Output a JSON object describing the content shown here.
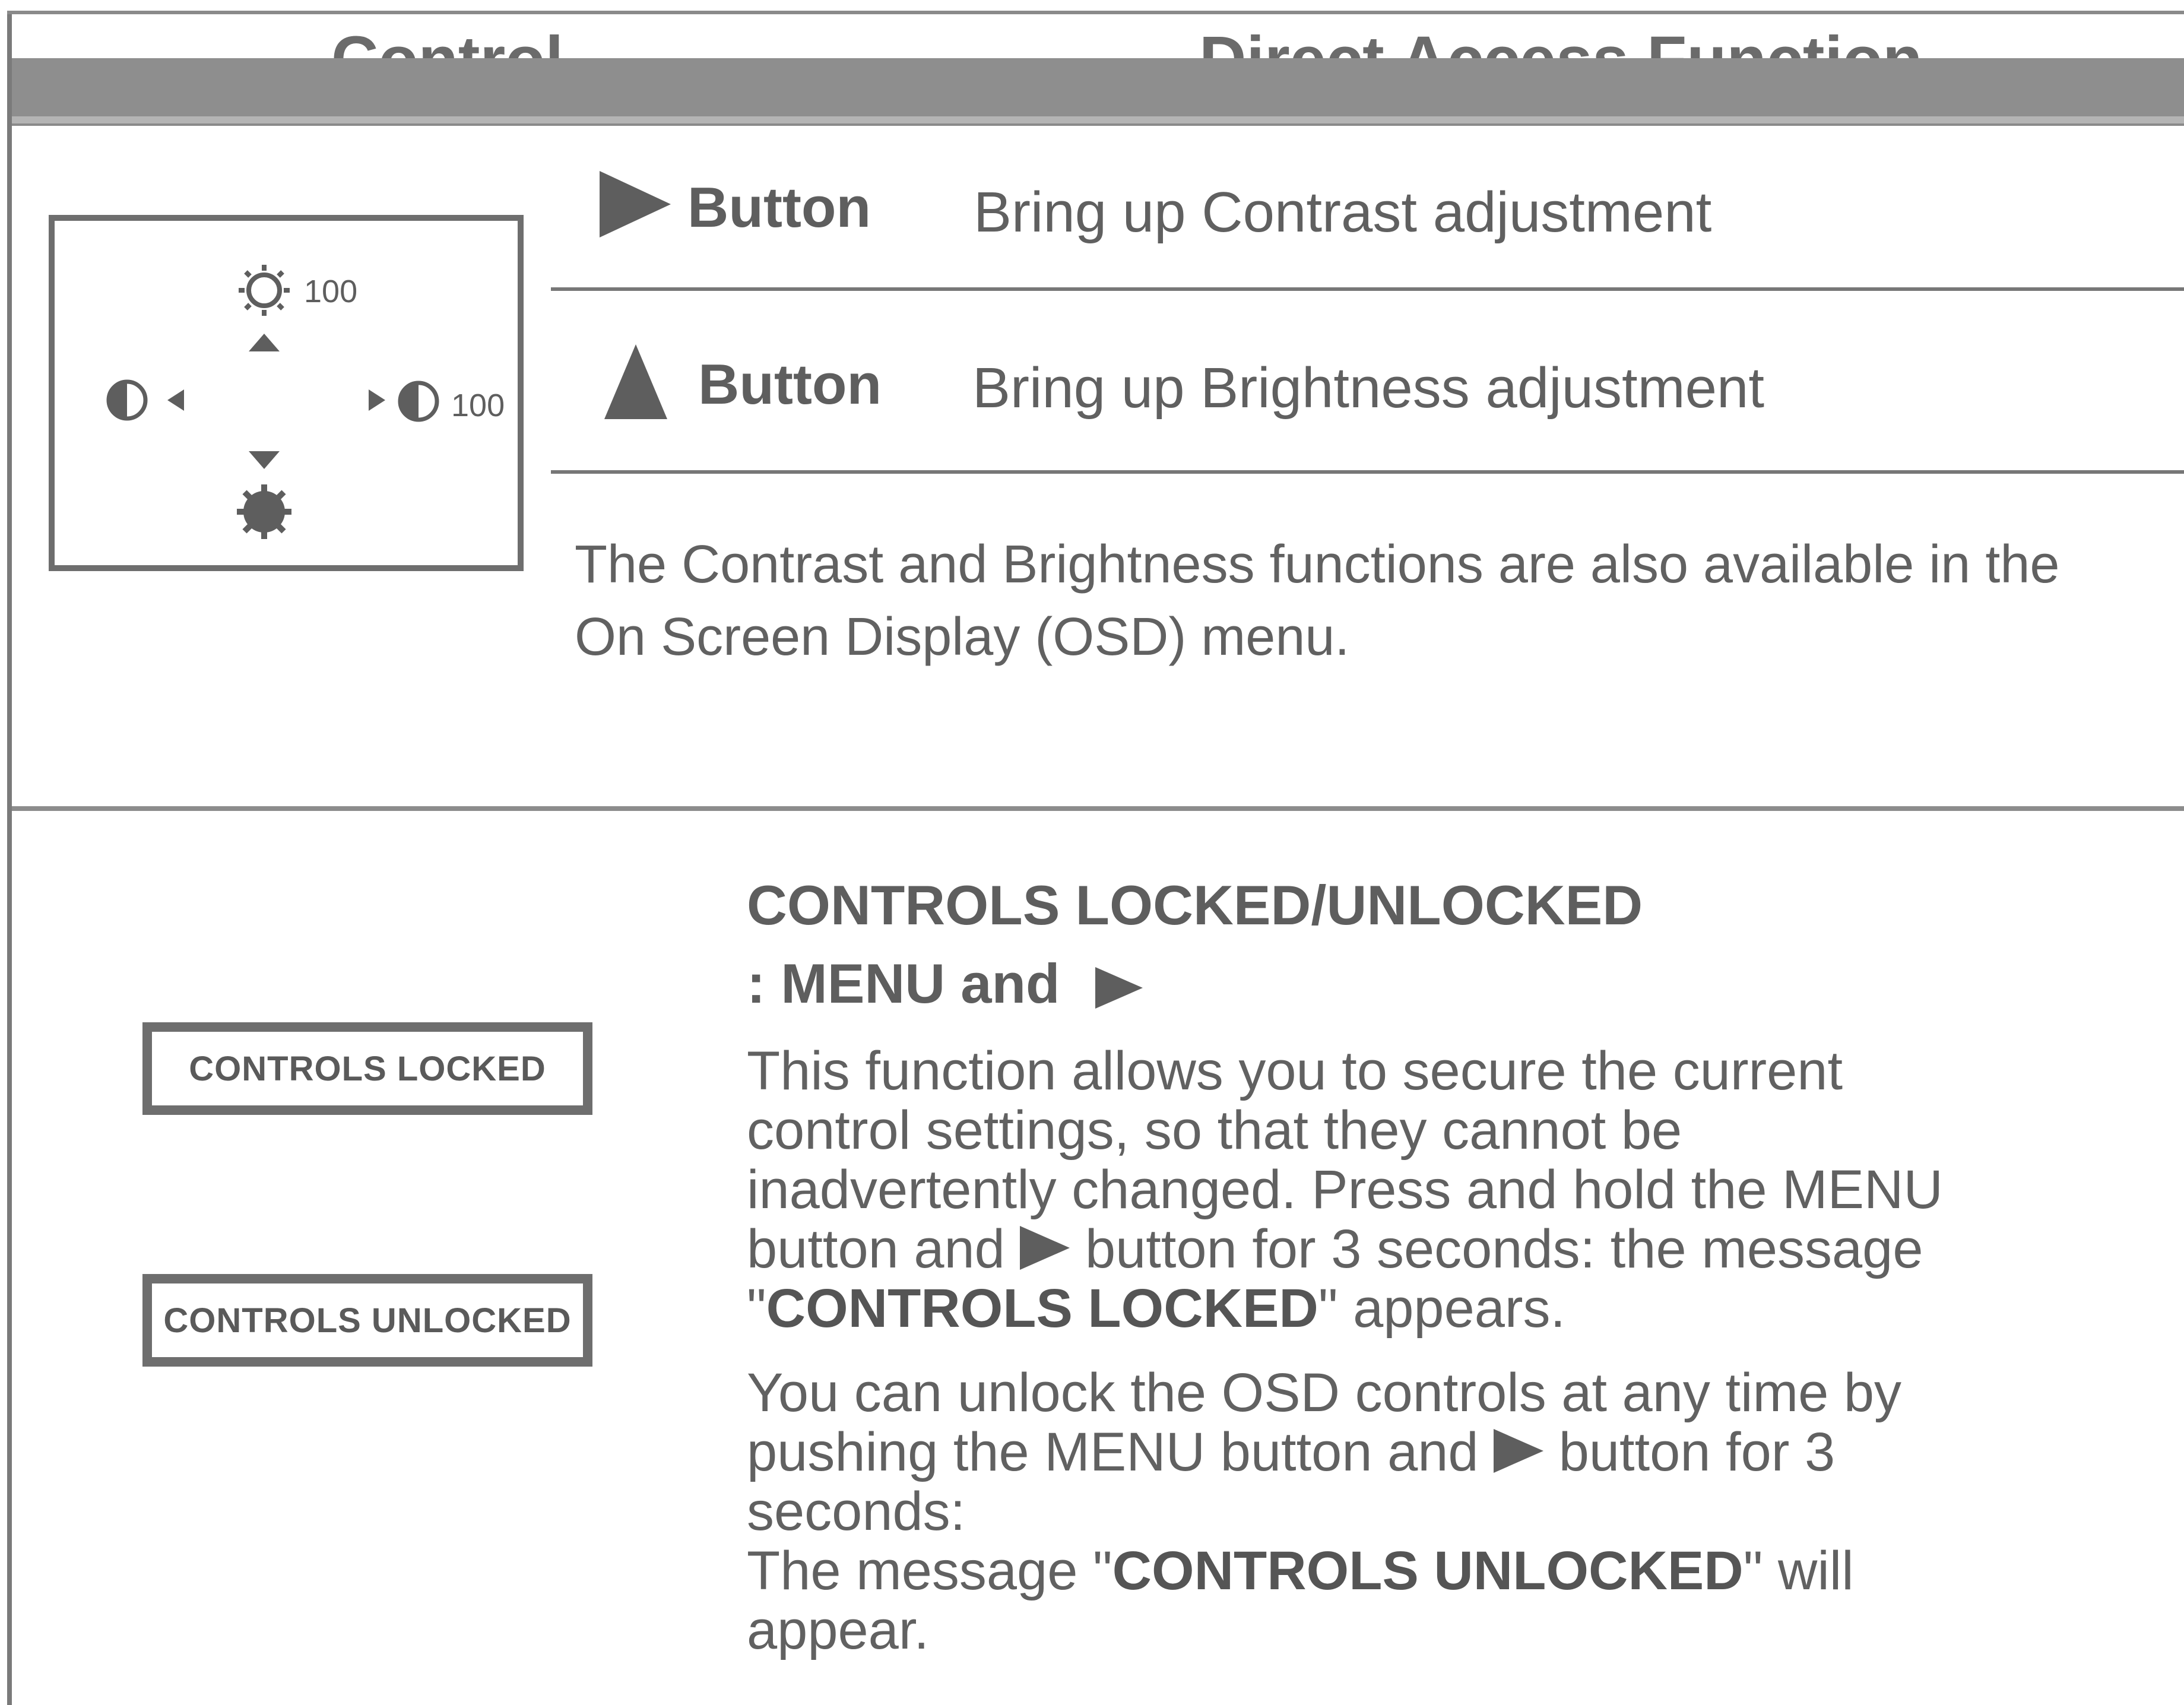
{
  "header": {
    "control_label": "Control",
    "function_label": "Direct Access Function"
  },
  "osd_preview": {
    "brightness_value": "100",
    "contrast_value": "100",
    "icons": [
      "sun-outline-icon",
      "up-arrow-icon",
      "contrast-icon",
      "left-arrow-icon",
      "right-arrow-icon",
      "contrast-icon",
      "down-arrow-icon",
      "sun-filled-icon"
    ]
  },
  "direct_access": [
    {
      "glyph": "right-triangle-icon",
      "button_label": "Button",
      "description": "Bring up Contrast adjustment"
    },
    {
      "glyph": "up-triangle-icon",
      "button_label": "Button",
      "description": "Bring up Brightness adjustment"
    }
  ],
  "note": {
    "line1": "The Contrast and Brightness functions are also available in the",
    "line2": "On Screen Display (OSD) menu."
  },
  "lock_messages": {
    "locked": "CONTROLS LOCKED",
    "unlocked": "CONTROLS UNLOCKED"
  },
  "controls_lock": {
    "title": "CONTROLS LOCKED/UNLOCKED",
    "subtitle": ": MENU and",
    "para1": {
      "l1": "This function allows you to secure the current",
      "l2": "control settings, so that they cannot be",
      "l3": "inadvertently changed. Press and hold the MENU",
      "l4a": "button and",
      "l4b": "button for 3 seconds: the message",
      "l5_quote_open": "\"",
      "l5_bold": "CONTROLS LOCKED",
      "l5_rest": "\" appears."
    },
    "para2": {
      "l1": "You can unlock the OSD controls at any time by",
      "l2a": "pushing the MENU button and",
      "l2b": "button for 3",
      "l3": "seconds:",
      "l4_pre": "The message \"",
      "l4_bold": "CONTROLS UNLOCKED",
      "l4_post": "\" will",
      "l5": "appear."
    }
  },
  "colors": {
    "text": "#5e5e5e",
    "bar": "#8e8e8e",
    "border": "#6e6e6e"
  }
}
